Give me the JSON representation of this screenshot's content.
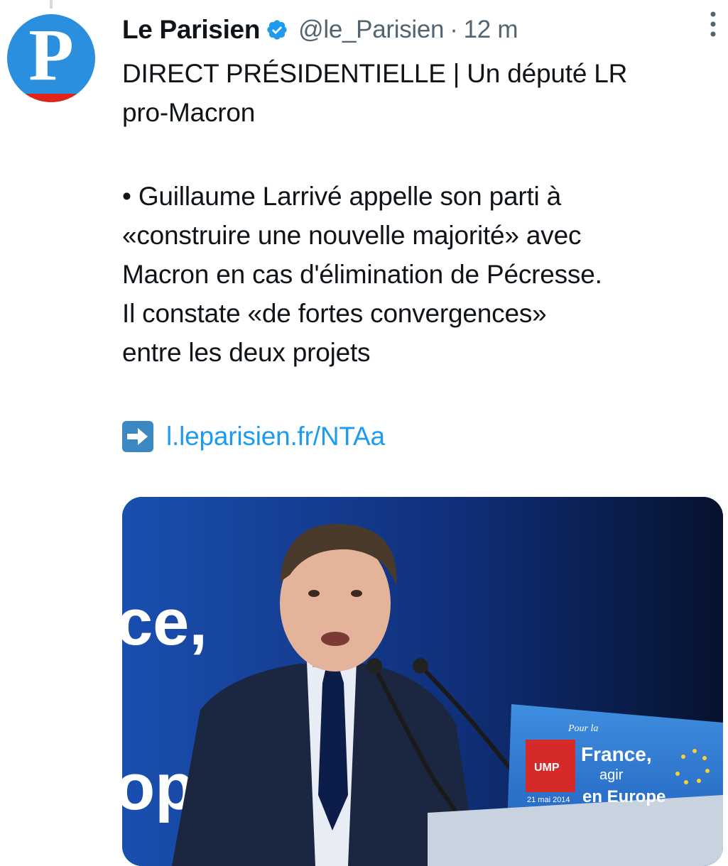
{
  "tweet": {
    "avatar_letter": "P",
    "author_name": "Le Parisien",
    "handle": "@le_Parisien",
    "separator": "·",
    "time": "12 m",
    "text_lines": [
      "DIRECT PRÉSIDENTIELLE | Un député LR",
      "pro-Macron"
    ],
    "body_lines": [
      "• Guillaume Larrivé appelle son parti à",
      "«construire une nouvelle majorité» avec",
      "Macron en cas d'élimination de Pécresse.",
      "Il constate «de fortes convergences»",
      "entre les deux projets"
    ],
    "link_text": "l.leparisien.fr/NTAa"
  },
  "media": {
    "backdrop_text_1": "ce,",
    "backdrop_text_2": "op",
    "podium_line_1": "Pour la",
    "podium_line_2": "France,",
    "podium_line_3": "agir",
    "podium_line_4": "en Europe",
    "podium_party": "UMP",
    "podium_date": "21 mai 2014"
  },
  "colors": {
    "brand_blue": "#1d9bf0",
    "avatar_blue": "#2b8fe0",
    "avatar_red": "#e2231a",
    "muted_text": "#536471"
  },
  "icons": {
    "verified": "verified-badge-icon",
    "more": "more-options-icon",
    "arrow": "right-arrow-emoji-icon"
  }
}
